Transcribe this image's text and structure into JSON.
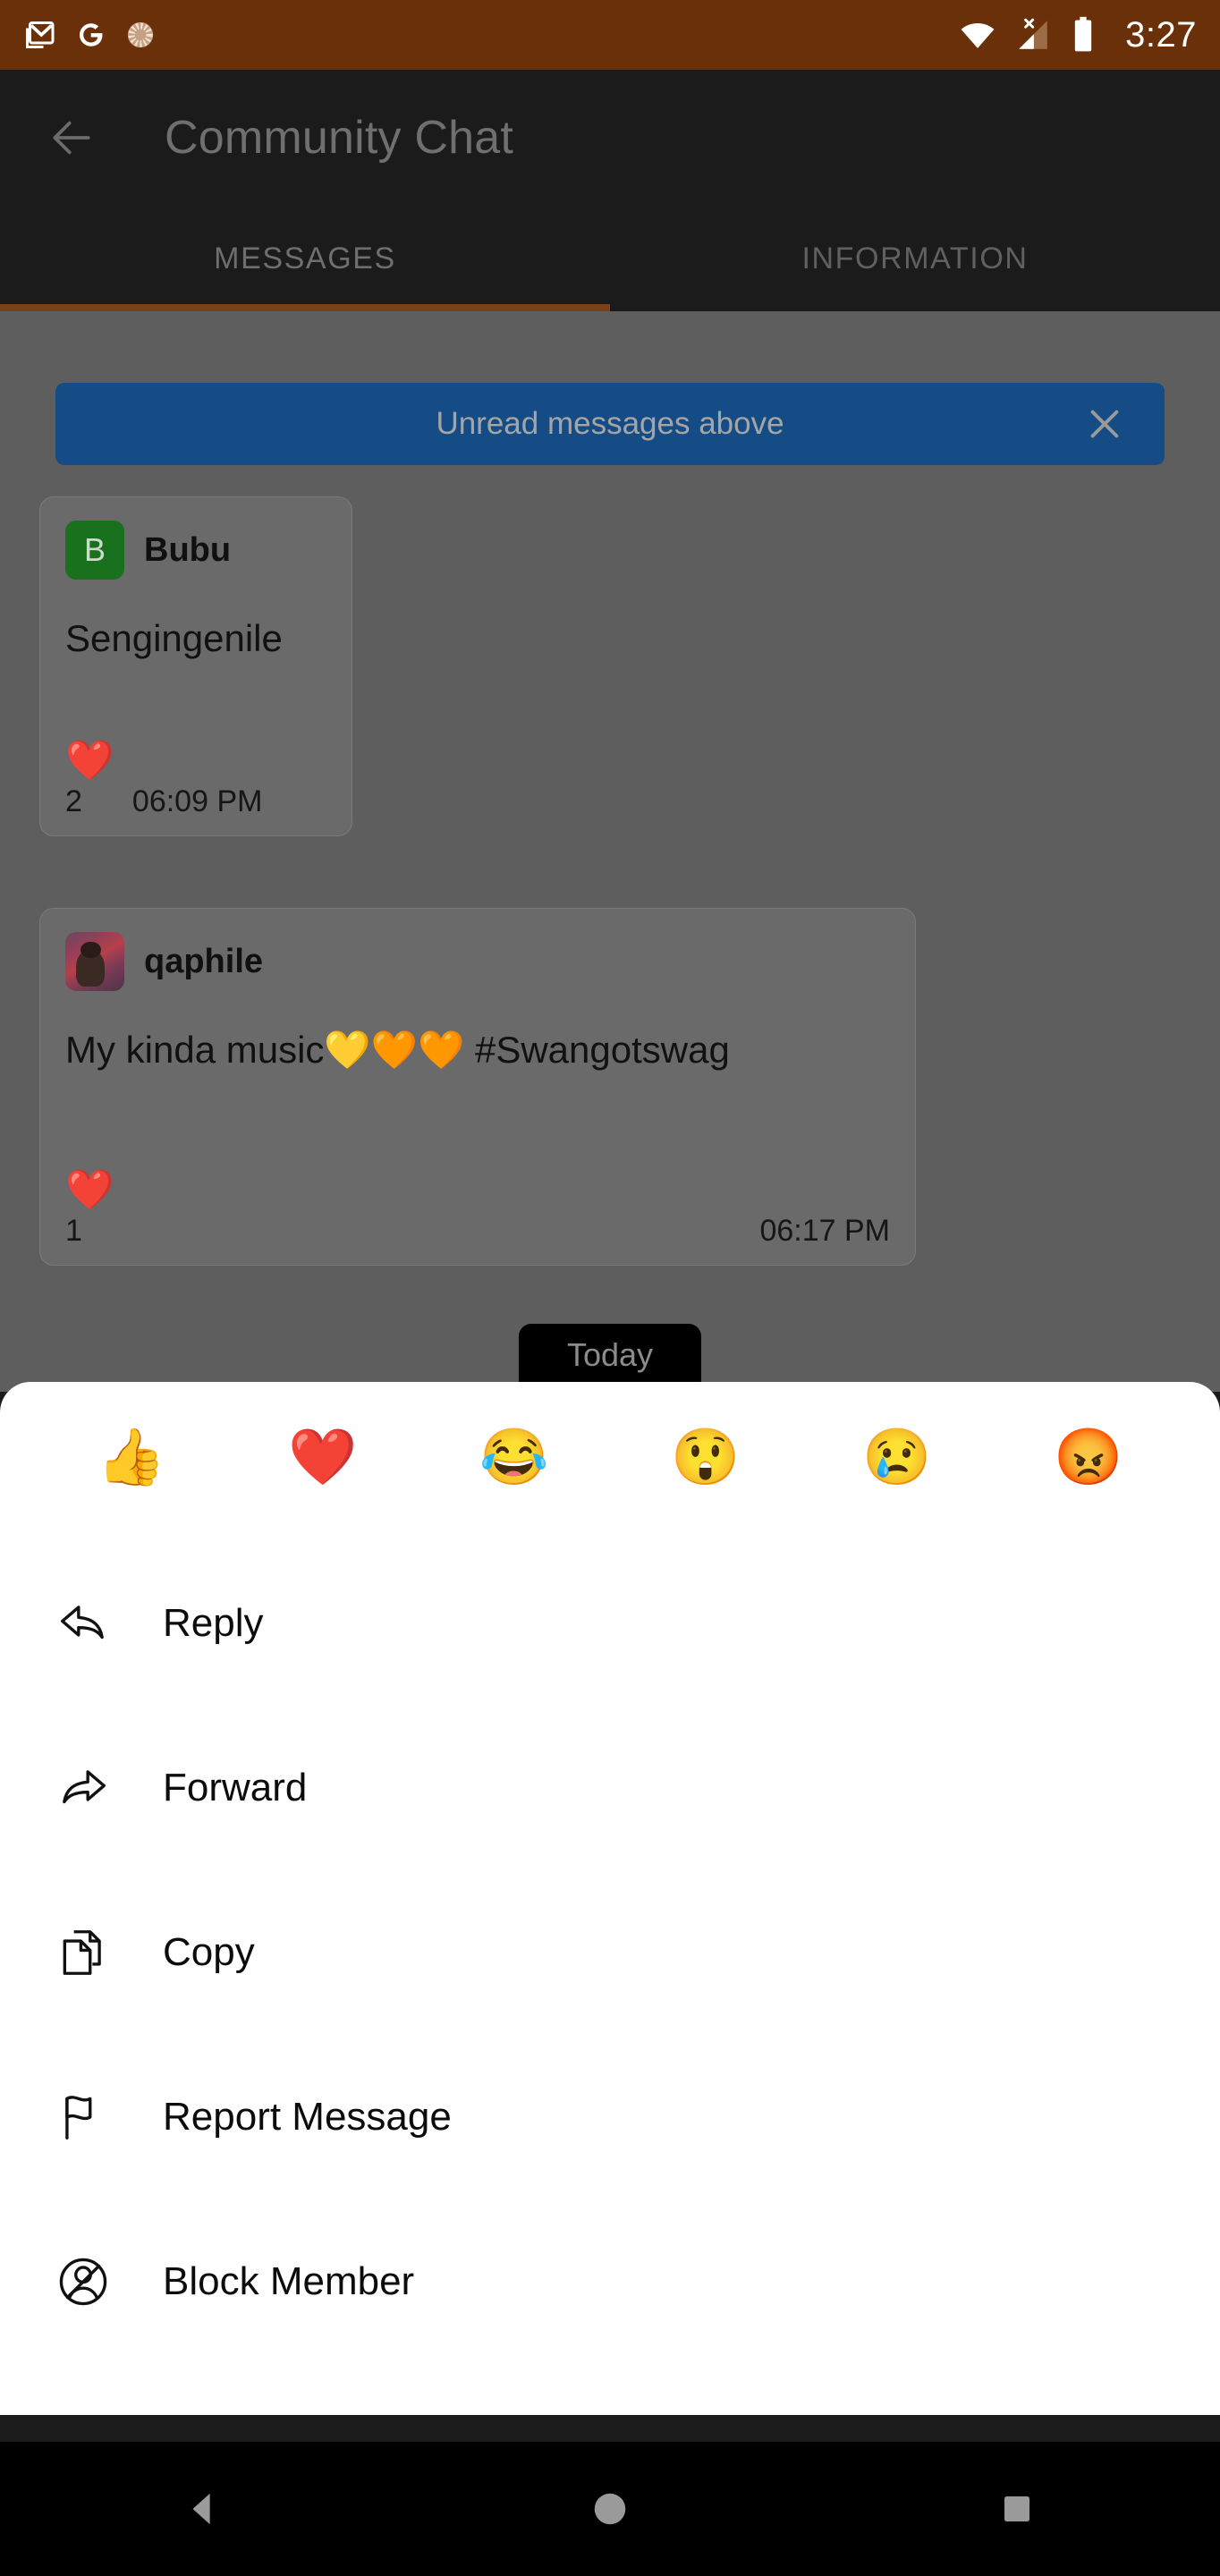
{
  "status_bar": {
    "time": "3:27",
    "background": "#693009",
    "left_icons": [
      "gmail-icon",
      "google-icon",
      "sync-progress-icon"
    ],
    "right_icons": [
      "wifi-icon",
      "cellular-no-service-icon",
      "battery-icon"
    ]
  },
  "app_bar": {
    "back_label": "back-arrow",
    "title": "Community Chat",
    "background": "#1b1b1b",
    "title_color": "#6f6f6f"
  },
  "tabs": {
    "items": [
      {
        "label": "MESSAGES",
        "active": true
      },
      {
        "label": "INFORMATION",
        "active": false
      }
    ],
    "indicator_color": "#784118"
  },
  "unread_banner": {
    "text": "Unread messages above",
    "background": "#164c85",
    "close_label": "close-icon"
  },
  "messages": [
    {
      "sender": "Bubu",
      "avatar_type": "initial",
      "avatar_initial": "B",
      "avatar_color": "#19701d",
      "text": "Sengingenile",
      "reaction_emoji": "❤️",
      "reaction_count": "2",
      "time": "06:09 PM"
    },
    {
      "sender": "qaphile",
      "avatar_type": "photo",
      "avatar_initial": "",
      "text": "My kinda music💛🧡🧡 #Swangotswag",
      "reaction_emoji": "❤️",
      "reaction_count": "1",
      "time": "06:17 PM"
    }
  ],
  "date_divider": {
    "label": "Today"
  },
  "bottom_sheet": {
    "reactions": [
      {
        "name": "thumbs-up-emoji",
        "glyph": "👍"
      },
      {
        "name": "red-heart-emoji",
        "glyph": "❤️"
      },
      {
        "name": "face-with-tears-of-joy-emoji",
        "glyph": "😂"
      },
      {
        "name": "astonished-face-emoji",
        "glyph": "😲"
      },
      {
        "name": "crying-face-emoji",
        "glyph": "😢"
      },
      {
        "name": "pouting-face-emoji",
        "glyph": "😡"
      }
    ],
    "menu_items": [
      {
        "label": "Reply",
        "icon": "reply-arrow-icon"
      },
      {
        "label": "Forward",
        "icon": "forward-arrow-icon"
      },
      {
        "label": "Copy",
        "icon": "copy-icon"
      },
      {
        "label": "Report Message",
        "icon": "flag-icon"
      },
      {
        "label": "Block Member",
        "icon": "block-member-icon"
      }
    ]
  },
  "nav_bar": {
    "buttons": [
      {
        "name": "back-button",
        "shape": "triangle"
      },
      {
        "name": "home-button",
        "shape": "circle"
      },
      {
        "name": "recents-button",
        "shape": "square"
      }
    ]
  }
}
